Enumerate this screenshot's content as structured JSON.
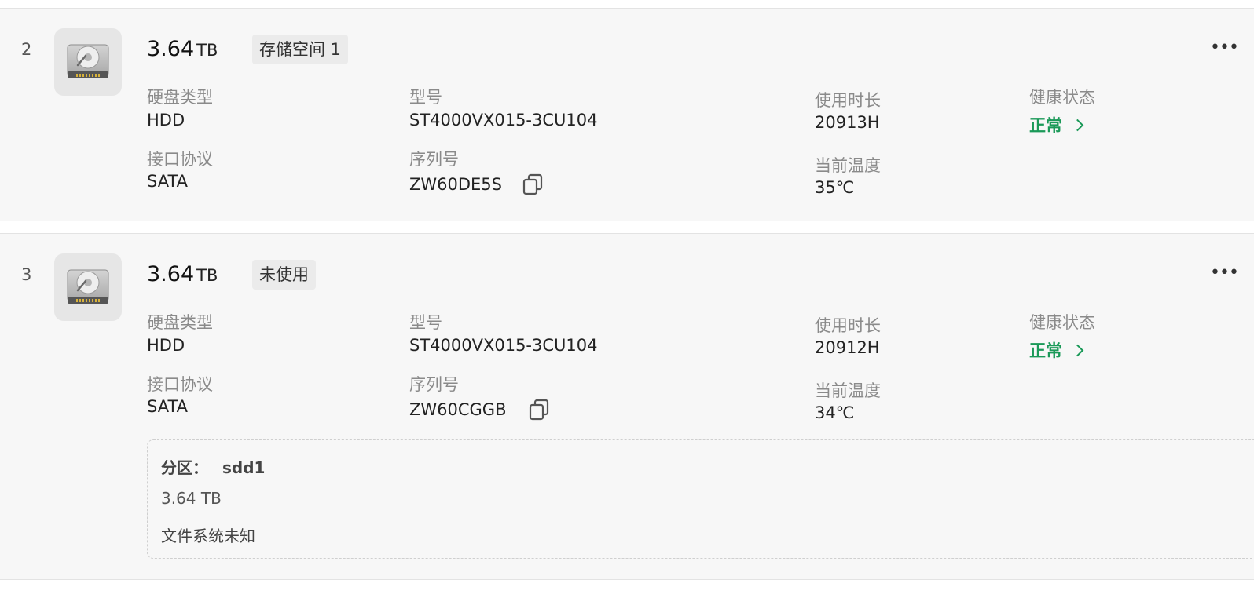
{
  "disks": [
    {
      "index": "2",
      "capacity_value": "3.64",
      "capacity_unit": "TB",
      "pool": "存储空间 1",
      "more_label": "•••",
      "labels": {
        "type": "硬盘类型",
        "model": "型号",
        "hours": "使用时长",
        "health": "健康状态",
        "interface": "接口协议",
        "serial": "序列号",
        "temperature": "当前温度"
      },
      "type": "HDD",
      "model": "ST4000VX015-3CU104",
      "hours": "20913H",
      "health": "正常",
      "interface": "SATA",
      "serial": "ZW60DE5S",
      "temperature": "35℃"
    },
    {
      "index": "3",
      "capacity_value": "3.64",
      "capacity_unit": "TB",
      "pool": "未使用",
      "more_label": "•••",
      "labels": {
        "type": "硬盘类型",
        "model": "型号",
        "hours": "使用时长",
        "health": "健康状态",
        "interface": "接口协议",
        "serial": "序列号",
        "temperature": "当前温度"
      },
      "type": "HDD",
      "model": "ST4000VX015-3CU104",
      "hours": "20912H",
      "health": "正常",
      "interface": "SATA",
      "serial": "ZW60CGGB",
      "temperature": "34℃",
      "partition": {
        "label": "分区：",
        "name": "sdd1",
        "size": "3.64 TB",
        "filesystem": "文件系统未知"
      }
    }
  ],
  "colors": {
    "health_ok": "#1a9958",
    "card_bg": "#f7f7f7",
    "label": "#8a8a8a"
  },
  "icons": {
    "disk": "hard-disk-icon",
    "copy": "copy-icon",
    "more": "more-icon",
    "chevron": "chevron-right-icon"
  }
}
